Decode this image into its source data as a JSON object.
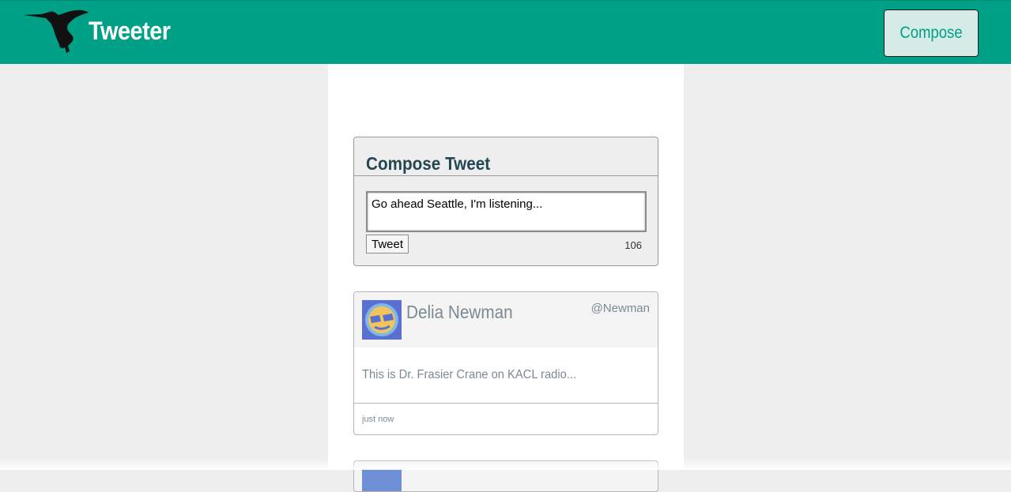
{
  "navbar": {
    "brand": "Tweeter",
    "logo_icon": "hummingbird-icon",
    "compose_label": "Compose",
    "bg_color": "#00a087"
  },
  "compose": {
    "title": "Compose Tweet",
    "textarea_value": "Go ahead Seattle, I'm listening...",
    "tweet_button": "Tweet",
    "counter": "106"
  },
  "tweets": [
    {
      "name": "Delia Newman",
      "handle": "@Newman",
      "body": "This is Dr. Frasier Crane on KACL radio...",
      "timestamp": "just now",
      "avatar_icon": "smiley-avatar-icon"
    }
  ]
}
